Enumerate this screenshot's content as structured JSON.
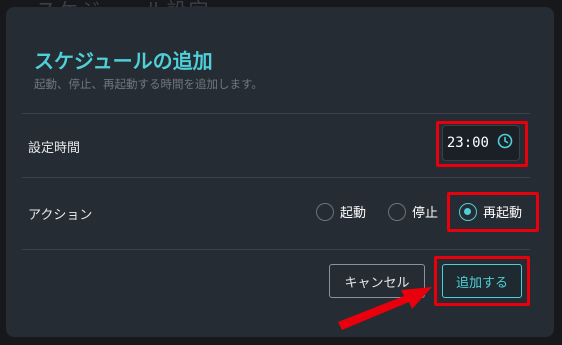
{
  "background": {
    "title": "スケジュール設定"
  },
  "dialog": {
    "title": "スケジュールの追加",
    "subtitle": "起動、停止、再起動する時間を追加します。",
    "time_row": {
      "label": "設定時間",
      "value": "23:00"
    },
    "action_row": {
      "label": "アクション",
      "options": [
        {
          "label": "起動",
          "checked": false
        },
        {
          "label": "停止",
          "checked": false
        },
        {
          "label": "再起動",
          "checked": true
        }
      ]
    },
    "buttons": {
      "cancel": "キャンセル",
      "add": "追加する"
    }
  },
  "colors": {
    "accent": "#4dd0d8",
    "highlight": "#e8000d",
    "dialog_bg": "#262c33"
  },
  "icons": {
    "time": "clock-icon",
    "annotation": "red-arrow-icon"
  }
}
